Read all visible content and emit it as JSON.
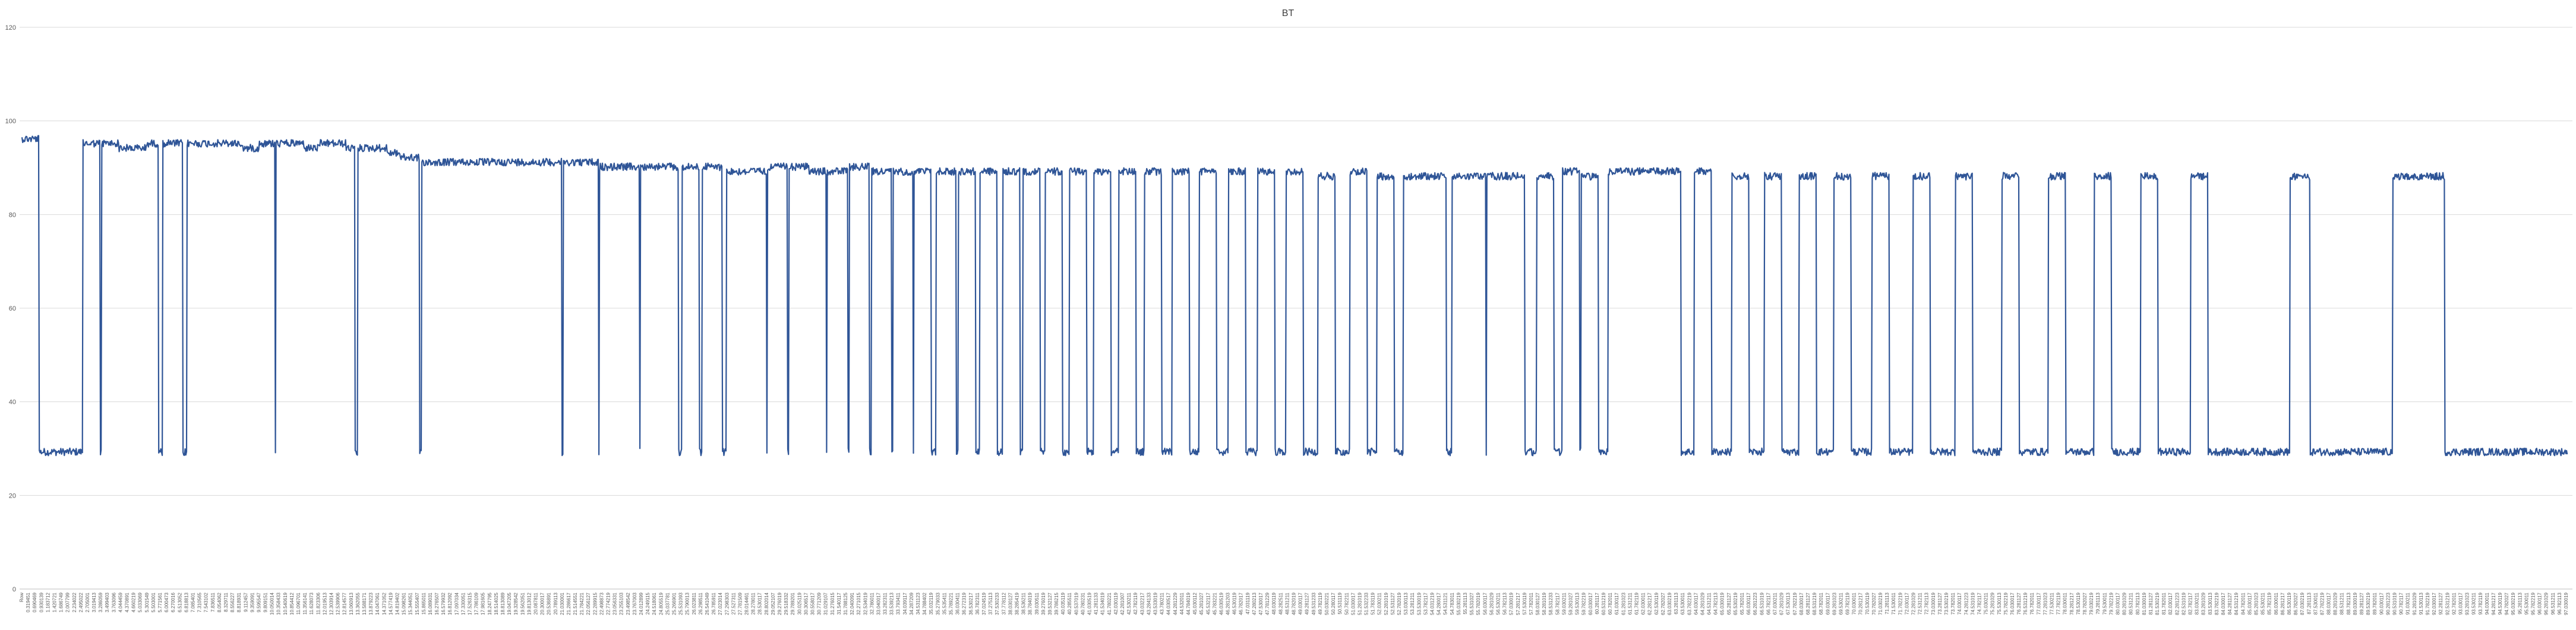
{
  "chart_data": {
    "type": "line",
    "title": "BT",
    "xlabel": "",
    "ylabel": "",
    "ylim": [
      0,
      120
    ],
    "yticks": [
      0,
      20,
      40,
      60,
      80,
      100,
      120
    ],
    "grid": true,
    "legend": "none",
    "x_start_label": "Row",
    "x_labels": [
      "0.319451",
      "0.690469",
      "0.930139",
      "1.183712",
      "1.420721",
      "1.686749",
      "2.007799",
      "2.234022",
      "2.495022",
      "2.705001",
      "3.019413",
      "3.286059",
      "3.499403",
      "3.763096",
      "4.044459",
      "4.370891",
      "4.660219",
      "5.033069",
      "5.301549",
      "5.503001",
      "5.771561",
      "6.000473",
      "6.270016",
      "6.513052",
      "6.818813",
      "7.085401",
      "7.310565",
      "7.543102",
      "7.836511",
      "8.054062",
      "8.329711",
      "8.556227",
      "8.818931",
      "9.112457",
      "9.359091",
      "9.595547",
      "9.809151",
      "10.050014",
      "10.358433",
      "10.540619",
      "10.854412",
      "11.096701",
      "11.356141",
      "11.628073",
      "11.823306",
      "12.019513",
      "12.303914",
      "12.539906",
      "12.814577",
      "13.060913",
      "13.362055",
      "13.588171",
      "13.879223",
      "14.047061",
      "14.371052",
      "14.577419",
      "14.819402",
      "15.098261",
      "15.344051",
      "15.555407",
      "15.865011",
      "16.089031",
      "16.276507",
      "16.579932",
      "16.812092",
      "17.097034",
      "17.330051",
      "17.526315",
      "17.786109",
      "17.981605",
      "18.247795",
      "18.514025",
      "18.813089",
      "19.047205",
      "19.328542",
      "19.562051",
      "19.813012",
      "20.087811",
      "20.300017",
      "20.536891",
      "20.789113",
      "21.030001",
      "21.286617",
      "21.514551",
      "21.784221",
      "22.056127",
      "22.289915",
      "22.498873",
      "22.774219",
      "23.056331",
      "23.255103",
      "23.498542",
      "23.767003",
      "24.012899",
      "24.249115",
      "24.518061",
      "24.805519",
      "25.037781",
      "25.266901",
      "25.531093",
      "25.790013",
      "26.023811",
      "26.298511",
      "26.541049",
      "26.785911",
      "27.023014",
      "27.298303",
      "27.527311",
      "27.781509",
      "28.014461",
      "28.278011",
      "28.530117",
      "28.802014",
      "29.052107",
      "29.276019",
      "29.518332",
      "29.789201",
      "30.025119",
      "30.306517",
      "30.558017",
      "30.771209",
      "31.029107",
      "31.276015",
      "31.540117",
      "31.788125",
      "32.040091",
      "32.271015",
      "32.534019",
      "32.786011",
      "33.040017",
      "33.282311",
      "33.539213",
      "33.793411",
      "34.039117",
      "34.287209",
      "34.531123",
      "34.788402",
      "35.032119",
      "35.279033",
      "35.535411",
      "35.789221",
      "36.030411",
      "36.272319",
      "36.530217",
      "36.782311",
      "37.024519",
      "37.275113",
      "37.530233",
      "37.778112",
      "38.030127",
      "38.285419",
      "38.536211",
      "38.784019",
      "39.030511",
      "39.276019",
      "39.532127",
      "39.786215",
      "40.035119",
      "40.285511",
      "40.537019",
      "40.780231",
      "41.030519",
      "41.281133",
      "41.534019",
      "41.780221",
      "42.030119",
      "42.281007",
      "42.530211",
      "42.782119",
      "43.032217",
      "43.284133",
      "43.533019",
      "43.780211",
      "44.030517",
      "44.281229",
      "44.532011",
      "44.784019",
      "45.030112",
      "45.281027",
      "45.532117",
      "45.783221",
      "46.030519",
      "46.281203",
      "46.530119",
      "46.782017",
      "47.031119",
      "47.280213",
      "47.530017",
      "47.781229",
      "48.030119",
      "48.282511",
      "48.531211",
      "48.782019",
      "49.030117",
      "49.281127",
      "49.531233",
      "49.782119",
      "50.030221",
      "50.280117",
      "50.531119",
      "50.782211",
      "51.030017",
      "51.281019",
      "51.532233",
      "51.783119",
      "52.030211",
      "52.281019",
      "52.531127",
      "52.782019",
      "53.030113",
      "53.281211",
      "53.530019",
      "53.782117",
      "54.031219",
      "54.280017",
      "54.531121",
      "54.783011",
      "55.030219",
      "55.281113",
      "55.531027",
      "55.782019",
      "56.030117",
      "56.281029",
      "56.530211",
      "56.782113",
      "57.030019",
      "57.281217",
      "57.530119",
      "57.782011",
      "58.030127",
      "58.281019",
      "58.531233",
      "58.782117",
      "59.030211",
      "59.281027",
      "59.530113",
      "59.782219",
      "60.030017",
      "60.281117",
      "60.531219",
      "60.782011",
      "61.030117",
      "61.281023",
      "61.531211",
      "61.782119",
      "62.030011",
      "62.281217",
      "62.530119",
      "62.782027",
      "63.030219",
      "63.281113",
      "63.530011",
      "63.782219",
      "64.030117",
      "64.281029",
      "64.531211",
      "64.782113",
      "65.030019",
      "65.281127",
      "65.530219",
      "65.782011",
      "66.030117",
      "66.281223",
      "66.531019",
      "66.782117",
      "67.030211",
      "67.281029",
      "67.530113",
      "67.782219",
      "68.030017",
      "68.281127",
      "68.531219",
      "68.782011",
      "69.030117",
      "69.281023",
      "69.530211",
      "69.782119",
      "70.030011",
      "70.281217",
      "70.530119",
      "70.782027",
      "71.030219",
      "71.281113",
      "71.530011",
      "71.782219",
      "72.030117",
      "72.281029",
      "72.531211",
      "72.782113",
      "73.030019",
      "73.281127",
      "73.530219",
      "73.782011",
      "74.030117",
      "74.281223",
      "74.531019",
      "74.782117",
      "75.030211",
      "75.281029",
      "75.530113",
      "75.782219",
      "76.030017",
      "76.281127",
      "76.531219",
      "76.782011",
      "77.030117",
      "77.281023",
      "77.530211",
      "77.782119",
      "78.030011",
      "78.281217",
      "78.530119",
      "78.782027",
      "79.030219",
      "79.281113",
      "79.530011",
      "79.782219",
      "80.030117",
      "80.281029",
      "80.531211",
      "80.782113",
      "81.030019",
      "81.281127",
      "81.530219",
      "81.782011",
      "82.030117",
      "82.281223",
      "82.531019",
      "82.782117",
      "83.030211",
      "83.281029",
      "83.530113",
      "83.782219",
      "84.030017",
      "84.281127",
      "84.531219",
      "84.782011",
      "85.030117",
      "85.281023",
      "85.530211",
      "85.782119",
      "86.030011",
      "86.281217",
      "86.530119",
      "86.782027",
      "87.030219",
      "87.281113",
      "87.530011",
      "87.782219",
      "88.030117",
      "88.281029",
      "88.531211",
      "88.782113",
      "89.030019",
      "89.281127",
      "89.530219",
      "89.782011",
      "90.030117",
      "90.281223",
      "90.531019",
      "90.782117",
      "91.030211",
      "91.281029",
      "91.530113",
      "91.782219",
      "92.030017",
      "92.281127",
      "92.531219",
      "92.782011",
      "93.030117",
      "93.281023",
      "93.530211",
      "93.782119",
      "94.030011",
      "94.281217",
      "94.530119",
      "94.782027",
      "95.030219",
      "95.281113",
      "95.530011",
      "95.782219",
      "96.030117",
      "96.281029",
      "96.531211",
      "96.782113",
      "97.030019"
    ],
    "baseline": 29.3,
    "pulses": [
      [
        0.0,
        0.3,
        97
      ],
      [
        1.05,
        0.3,
        96
      ],
      [
        1.38,
        0.3,
        96
      ],
      [
        1.63,
        0.3,
        95
      ],
      [
        1.85,
        0.3,
        95
      ],
      [
        2.06,
        0.3,
        96
      ],
      [
        2.43,
        0.35,
        96
      ],
      [
        2.85,
        0.5,
        96
      ],
      [
        3.25,
        0.55,
        96
      ],
      [
        3.6,
        0.5,
        95
      ],
      [
        4.02,
        0.35,
        96
      ],
      [
        4.38,
        0.5,
        96
      ],
      [
        4.7,
        0.45,
        95
      ],
      [
        5.1,
        0.5,
        96
      ],
      [
        5.4,
        0.35,
        95
      ],
      [
        5.8,
        0.5,
        95
      ],
      [
        6.08,
        0.45,
        94
      ],
      [
        6.52,
        0.35,
        93
      ],
      [
        6.9,
        0.35,
        92
      ],
      [
        7.18,
        0.35,
        92
      ],
      [
        7.45,
        0.35,
        92
      ],
      [
        7.78,
        0.35,
        92
      ],
      [
        8.04,
        0.3,
        92
      ],
      [
        8.35,
        0.35,
        92
      ],
      [
        8.68,
        0.35,
        92
      ],
      [
        8.98,
        0.35,
        92
      ],
      [
        9.35,
        0.35,
        92
      ],
      [
        9.62,
        0.35,
        92
      ],
      [
        9.98,
        0.35,
        91
      ],
      [
        10.32,
        0.35,
        91
      ],
      [
        10.68,
        0.35,
        91
      ],
      [
        11.0,
        0.35,
        91
      ],
      [
        11.4,
        0.3,
        91
      ],
      [
        11.75,
        0.35,
        91
      ],
      [
        12.18,
        0.35,
        90
      ],
      [
        12.52,
        0.35,
        90
      ],
      [
        12.88,
        0.35,
        91
      ],
      [
        13.25,
        0.35,
        91
      ],
      [
        13.55,
        0.35,
        90
      ],
      [
        13.92,
        0.35,
        90
      ],
      [
        14.3,
        0.35,
        91
      ],
      [
        14.68,
        0.35,
        90
      ],
      [
        15.05,
        0.35,
        90
      ],
      [
        15.42,
        0.3,
        90
      ],
      [
        15.8,
        0.35,
        90
      ],
      [
        16.18,
        0.3,
        90
      ],
      [
        16.55,
        0.3,
        90
      ],
      [
        16.95,
        0.3,
        90
      ],
      [
        17.3,
        0.3,
        90
      ],
      [
        17.68,
        0.3,
        90
      ],
      [
        18.1,
        0.3,
        90
      ],
      [
        18.52,
        0.3,
        90
      ],
      [
        18.95,
        0.3,
        90
      ],
      [
        19.4,
        0.3,
        90
      ],
      [
        19.88,
        0.3,
        90
      ],
      [
        20.35,
        0.3,
        90
      ],
      [
        20.85,
        0.3,
        90
      ],
      [
        21.35,
        0.3,
        90
      ],
      [
        21.85,
        0.3,
        90
      ],
      [
        22.4,
        0.3,
        89
      ],
      [
        22.95,
        0.3,
        90
      ],
      [
        23.42,
        0.3,
        89
      ],
      [
        23.88,
        0.55,
        89
      ],
      [
        24.32,
        0.3,
        89
      ],
      [
        24.72,
        0.3,
        89
      ],
      [
        25.0,
        0.3,
        89
      ],
      [
        25.32,
        0.45,
        89
      ],
      [
        25.68,
        0.3,
        89
      ],
      [
        26.18,
        0.3,
        89
      ],
      [
        26.62,
        0.3,
        90
      ],
      [
        26.95,
        0.3,
        89
      ],
      [
        27.42,
        1.25,
        90
      ],
      [
        28.9,
        0.3,
        90
      ],
      [
        29.55,
        0.3,
        89
      ],
      [
        30.12,
        0.3,
        89
      ],
      [
        30.72,
        0.3,
        89
      ],
      [
        31.32,
        0.3,
        89
      ],
      [
        31.98,
        0.3,
        89
      ],
      [
        32.68,
        0.3,
        89
      ],
      [
        33.42,
        0.3,
        89
      ],
      [
        34.22,
        0.3,
        89
      ],
      [
        35.02,
        0.3,
        89
      ],
      [
        35.82,
        0.3,
        89
      ],
      [
        36.62,
        0.3,
        89
      ],
      [
        37.48,
        0.3,
        89
      ],
      [
        39.2,
        0.35,
        89
      ],
      [
        40.98,
        0.9,
        89
      ]
    ],
    "x_span": 44.0
  }
}
